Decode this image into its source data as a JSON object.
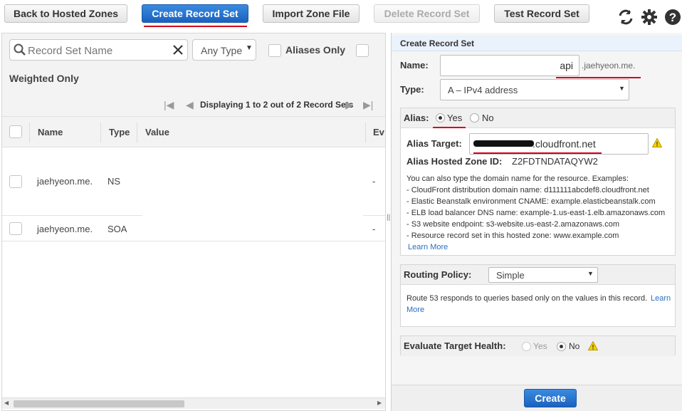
{
  "toolbar": {
    "back_label": "Back to Hosted Zones",
    "create_label": "Create Record Set",
    "import_label": "Import Zone File",
    "delete_label": "Delete Record Set",
    "test_label": "Test Record Set"
  },
  "filters": {
    "search_placeholder": "Record Set Name",
    "type_value": "Any Type",
    "aliases_only_label": "Aliases Only",
    "weighted_only_label": "Weighted Only"
  },
  "pager": {
    "text": "Displaying 1 to 2 out of 2 Record Sets"
  },
  "table": {
    "columns": [
      "Name",
      "Type",
      "Value",
      "Ev"
    ],
    "rows": [
      {
        "name": "jaehyeon.me.",
        "type": "NS",
        "value": "",
        "ev": "-"
      },
      {
        "name": "jaehyeon.me.",
        "type": "SOA",
        "value": "",
        "ev": "-"
      }
    ]
  },
  "panel": {
    "title": "Create Record Set",
    "name_label": "Name:",
    "name_value": "api",
    "name_suffix": ".jaehyeon.me.",
    "type_label": "Type:",
    "type_value": "A – IPv4 address",
    "alias_label": "Alias:",
    "alias_yes": "Yes",
    "alias_no": "No",
    "alias_target_label": "Alias Target:",
    "alias_target_value": ".cloudfront.net",
    "alias_zone_label": "Alias Hosted Zone ID:",
    "alias_zone_value": "Z2FDTNDATAQYW2",
    "help_intro": "You can also type the domain name for the resource. Examples:",
    "help_items": [
      "- CloudFront distribution domain name: d111111abcdef8.cloudfront.net",
      "- Elastic Beanstalk environment CNAME: example.elasticbeanstalk.com",
      "- ELB load balancer DNS name: example-1.us-east-1.elb.amazonaws.com",
      "- S3 website endpoint: s3-website.us-east-2.amazonaws.com",
      "- Resource record set in this hosted zone: www.example.com"
    ],
    "learn_more": "Learn More",
    "routing_label": "Routing Policy:",
    "routing_value": "Simple",
    "routing_help": "Route 53 responds to queries based only on the values in this record.",
    "routing_learn": "Learn",
    "routing_more": "More",
    "eval_label": "Evaluate Target Health:",
    "eval_yes": "Yes",
    "eval_no": "No",
    "create_label": "Create"
  }
}
